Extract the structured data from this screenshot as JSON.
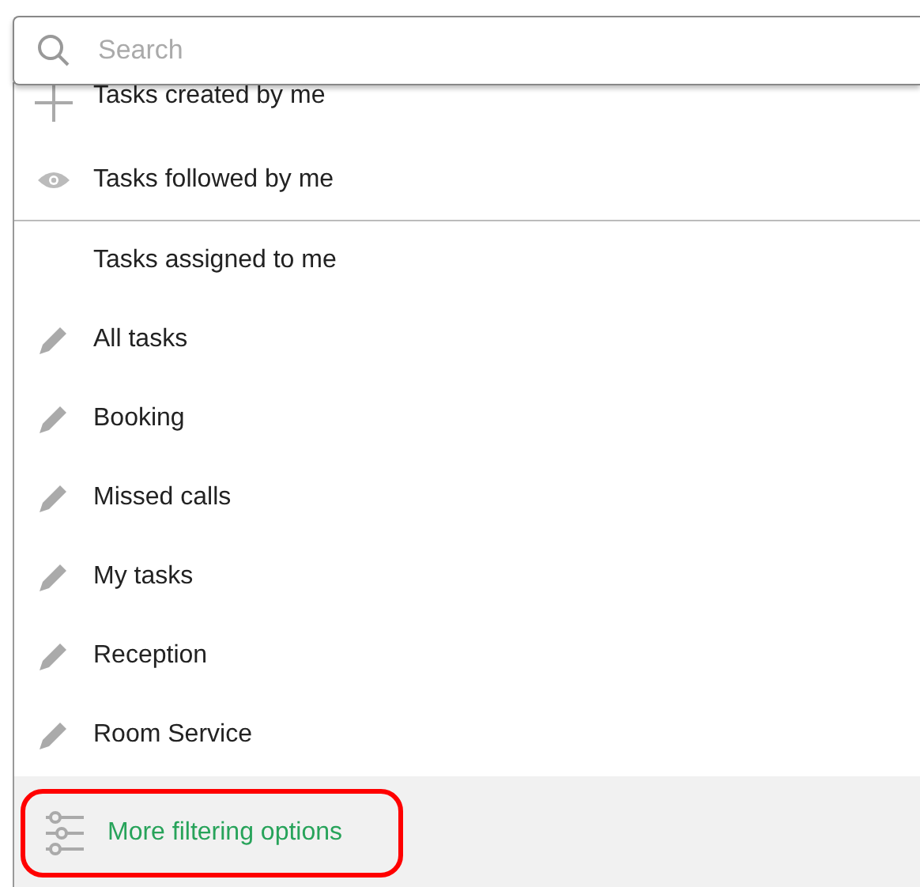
{
  "search": {
    "placeholder": "Search"
  },
  "sections": [
    {
      "items": [
        {
          "kind": "plus",
          "label": "Tasks created by me"
        },
        {
          "kind": "eye",
          "label": "Tasks followed by me"
        }
      ]
    },
    {
      "items": [
        {
          "kind": "none",
          "label": "Tasks assigned to me"
        },
        {
          "kind": "pencil",
          "label": "All tasks"
        },
        {
          "kind": "pencil",
          "label": "Booking"
        },
        {
          "kind": "pencil",
          "label": "Missed calls"
        },
        {
          "kind": "pencil",
          "label": "My tasks"
        },
        {
          "kind": "pencil",
          "label": "Reception"
        },
        {
          "kind": "pencil",
          "label": "Room Service"
        }
      ]
    }
  ],
  "footer": {
    "label": "More filtering options",
    "highlighted": true
  }
}
